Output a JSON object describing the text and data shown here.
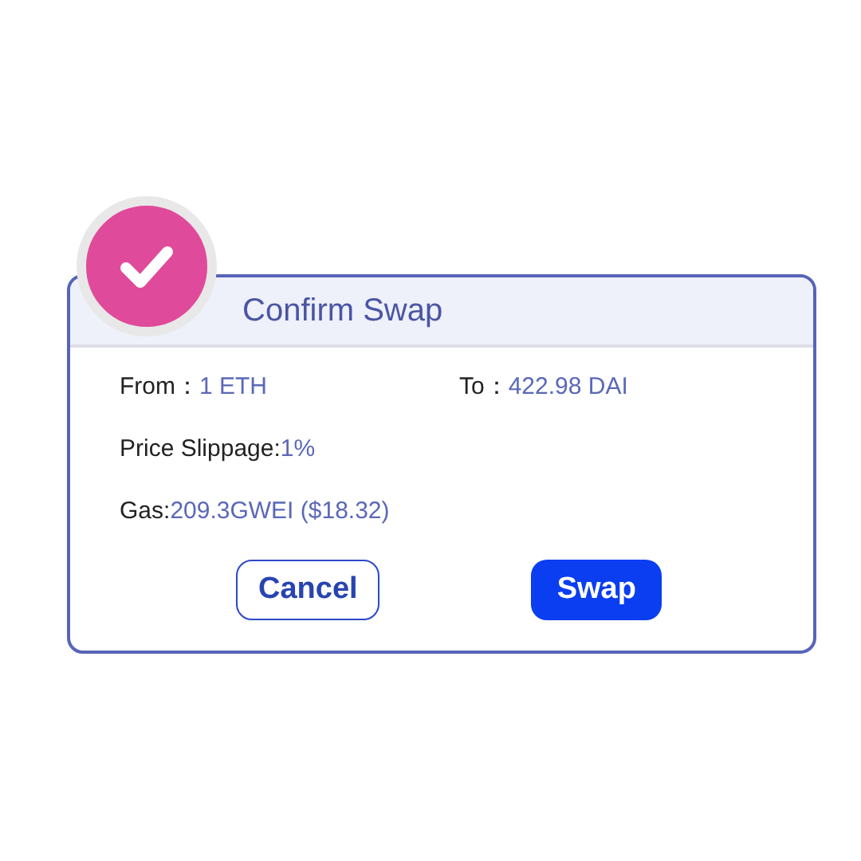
{
  "dialog": {
    "title": "Confirm Swap",
    "rows": [
      [
        {
          "label": "From：",
          "value": "1 ETH"
        },
        {
          "label": "To：",
          "value": "422.98 DAI"
        }
      ],
      [
        {
          "label": "Price Slippage: ",
          "value": "1%"
        }
      ],
      [
        {
          "label": "Gas: ",
          "value": "209.3GWEI ($18.32)"
        }
      ]
    ],
    "buttons": [
      {
        "label": "Cancel",
        "kind": "secondary"
      },
      {
        "label": "Swap",
        "kind": "primary"
      }
    ]
  }
}
